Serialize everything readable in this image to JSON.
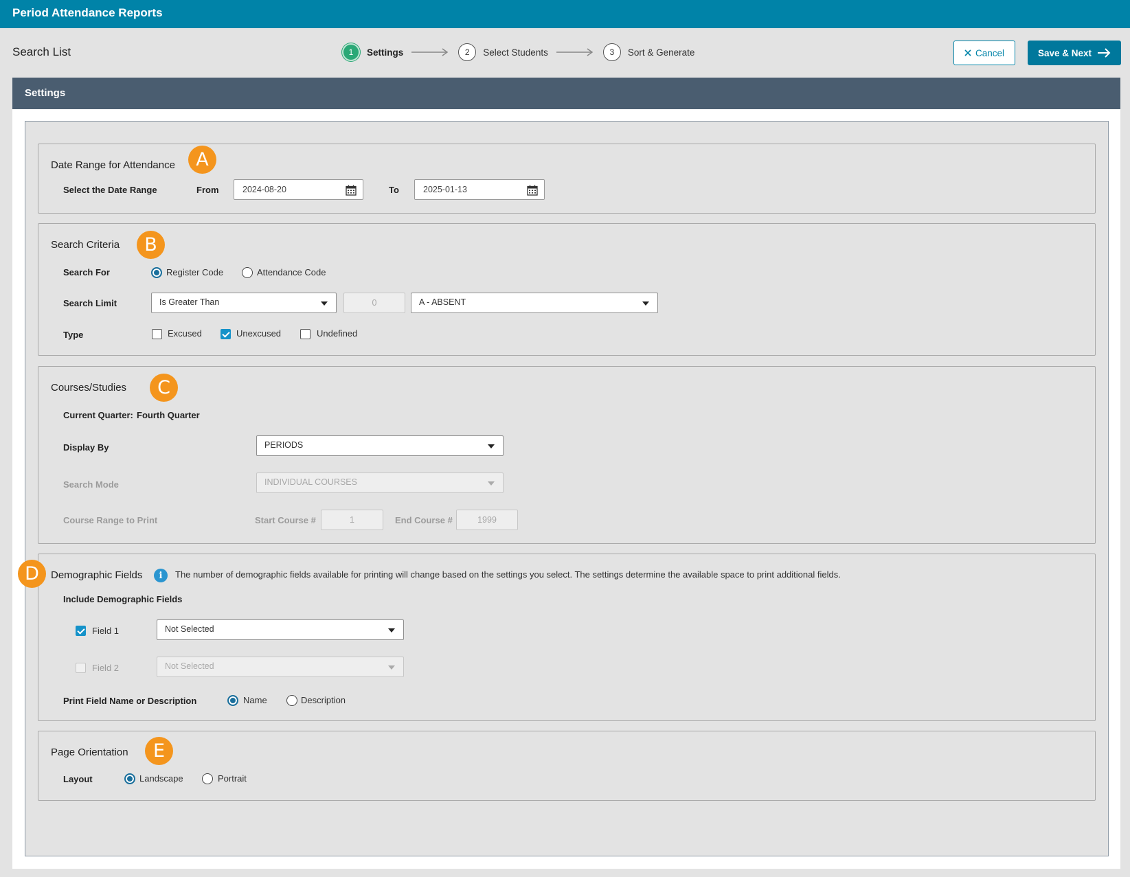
{
  "app": {
    "title": "Period Attendance Reports"
  },
  "page": {
    "heading": "Search List"
  },
  "wizard": {
    "steps": [
      {
        "number": "1",
        "label": "Settings"
      },
      {
        "number": "2",
        "label": "Select Students"
      },
      {
        "number": "3",
        "label": "Sort & Generate"
      }
    ],
    "active_step": 1
  },
  "actions": {
    "cancel_label": "Cancel",
    "save_label": "Save & Next"
  },
  "panel": {
    "title": "Settings"
  },
  "date_range": {
    "badge": "A",
    "title": "Date Range for Attendance",
    "label": "Select the Date Range",
    "from_label": "From",
    "from_value": "2024-08-20",
    "to_label": "To",
    "to_value": "2025-01-13"
  },
  "search_criteria": {
    "badge": "B",
    "title": "Search Criteria",
    "search_for_label": "Search For",
    "search_for_options": [
      "Register Code",
      "Attendance Code"
    ],
    "search_for_selected": "Register Code",
    "search_limit_label": "Search Limit",
    "limit_operator": "Is Greater Than",
    "limit_value": "0",
    "limit_code": "A - ABSENT",
    "type_label": "Type",
    "type_options": [
      {
        "label": "Excused",
        "checked": false
      },
      {
        "label": "Unexcused",
        "checked": true
      },
      {
        "label": "Undefined",
        "checked": false
      }
    ]
  },
  "courses": {
    "badge": "C",
    "title": "Courses/Studies",
    "current_quarter_label": "Current Quarter:",
    "current_quarter_value": "Fourth Quarter",
    "display_by_label": "Display By",
    "display_by_value": "PERIODS",
    "search_mode_label": "Search Mode",
    "search_mode_value": "INDIVIDUAL COURSES",
    "course_range_label": "Course Range to Print",
    "start_course_label": "Start Course #",
    "start_course_value": "1",
    "end_course_label": "End Course #",
    "end_course_value": "1999"
  },
  "demographics": {
    "badge": "D",
    "title": "Demographic Fields",
    "info_text": "The number of demographic fields available for printing will change based on the settings you select. The settings determine the available space to print additional fields.",
    "include_label": "Include Demographic Fields",
    "fields": [
      {
        "label": "Field 1",
        "checked": true,
        "value": "Not Selected",
        "enabled": true
      },
      {
        "label": "Field 2",
        "checked": false,
        "value": "Not Selected",
        "enabled": false
      }
    ],
    "print_label": "Print Field Name or Description",
    "print_options": [
      "Name",
      "Description"
    ],
    "print_selected": "Name"
  },
  "orientation": {
    "badge": "E",
    "title": "Page Orientation",
    "layout_label": "Layout",
    "options": [
      "Landscape",
      "Portrait"
    ],
    "selected": "Landscape"
  },
  "colors": {
    "topbar": "#0083a8",
    "panel_header": "#4a5d70",
    "badge": "#f4951d",
    "active_step": "#2aa876",
    "checkbox": "#1592c9"
  }
}
